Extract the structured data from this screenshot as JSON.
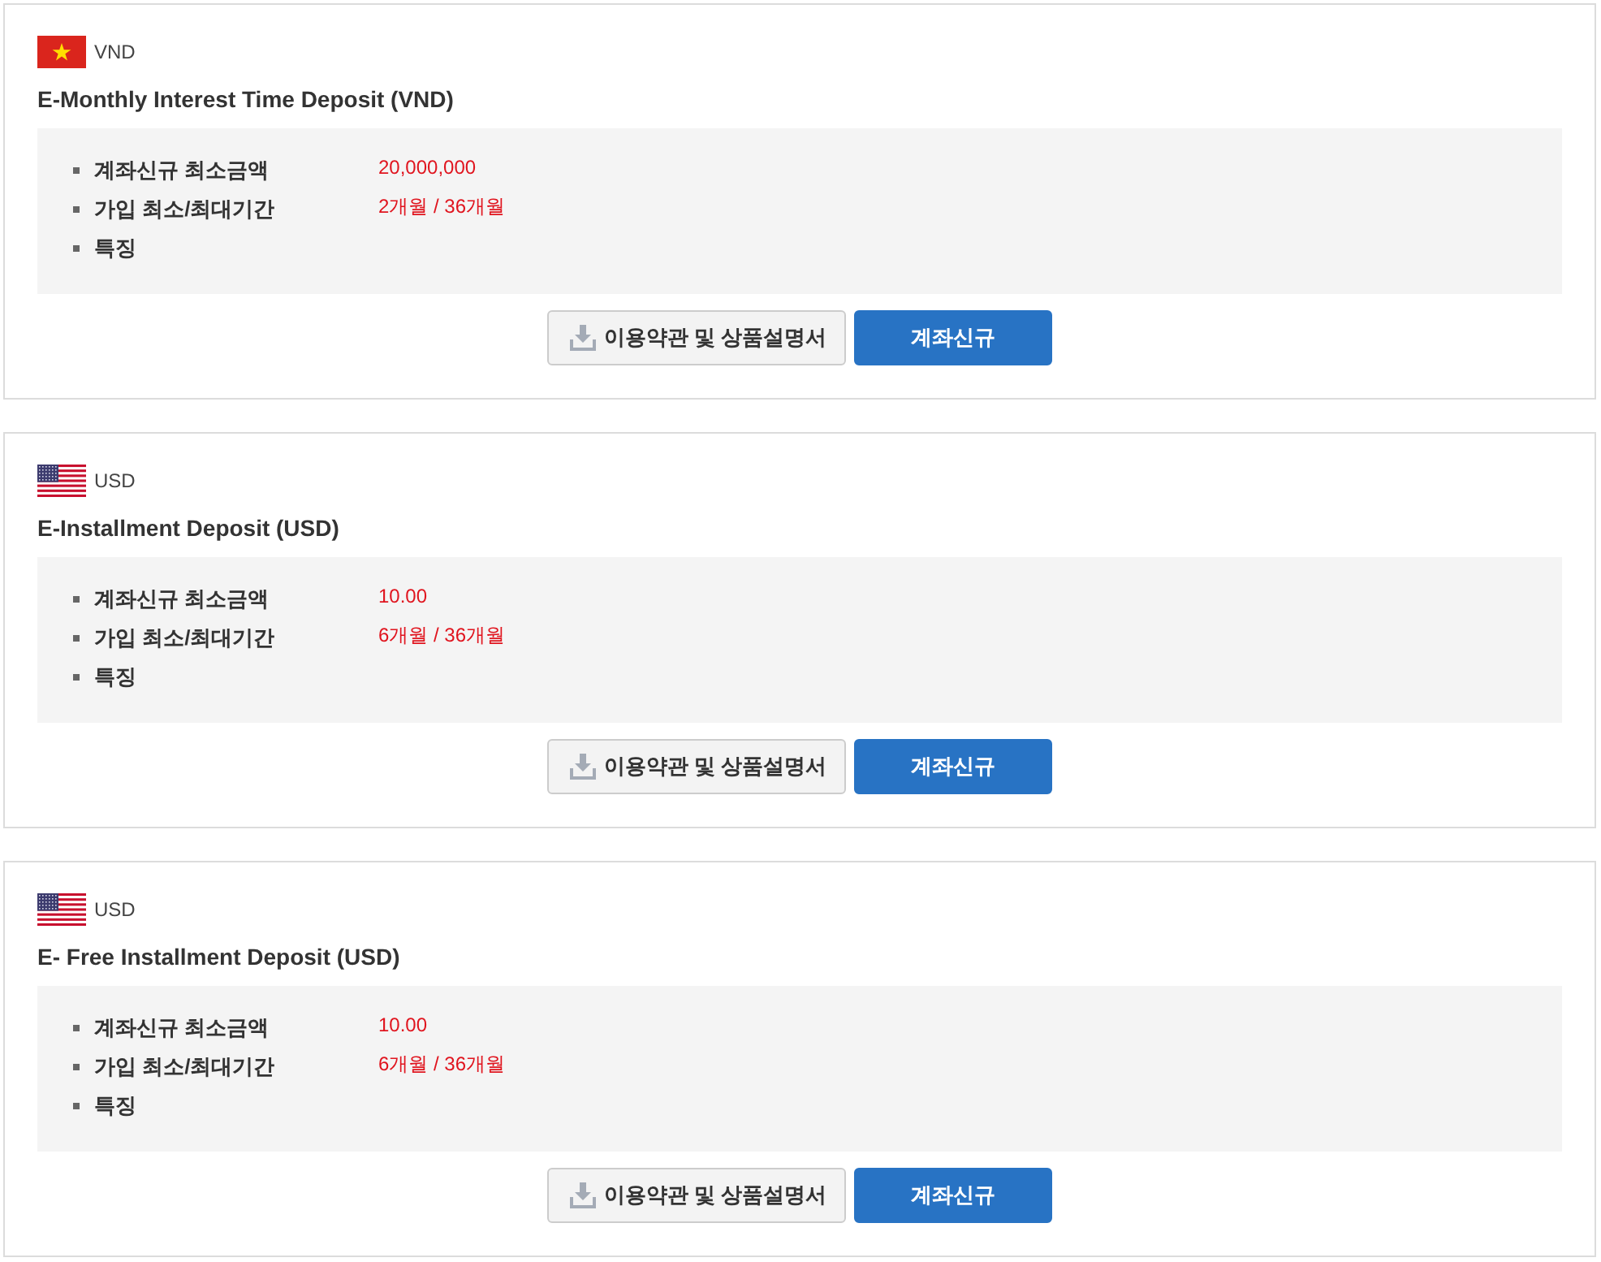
{
  "products": [
    {
      "currency": {
        "code": "VND",
        "kind": "vietnam"
      },
      "title": "E-Monthly Interest Time Deposit (VND)",
      "details": [
        {
          "label": "계좌신규 최소금액",
          "value": "20,000,000"
        },
        {
          "label": "가입 최소/최대기간",
          "value": "2개월 / 36개월"
        },
        {
          "label": "특징"
        }
      ],
      "buttons": [
        {
          "kind": "download",
          "label": "이용약관 및 상품설명서"
        },
        {
          "kind": "primary",
          "label": "계좌신규"
        }
      ]
    },
    {
      "currency": {
        "code": "USD",
        "kind": "usa"
      },
      "title": "E-Installment Deposit (USD)",
      "details": [
        {
          "label": "계좌신규 최소금액",
          "value": "10.00"
        },
        {
          "label": "가입 최소/최대기간",
          "value": "6개월 / 36개월"
        },
        {
          "label": "특징"
        }
      ],
      "buttons": [
        {
          "kind": "download",
          "label": "이용약관 및 상품설명서"
        },
        {
          "kind": "primary",
          "label": "계좌신규"
        }
      ]
    },
    {
      "currency": {
        "code": "USD",
        "kind": "usa"
      },
      "title": "E- Free Installment Deposit (USD)",
      "details": [
        {
          "label": "계좌신규 최소금액",
          "value": "10.00"
        },
        {
          "label": "가입 최소/최대기간",
          "value": "6개월 / 36개월"
        },
        {
          "label": "특징"
        }
      ],
      "buttons": [
        {
          "kind": "download",
          "label": "이용약관 및 상품설명서"
        },
        {
          "kind": "primary",
          "label": "계좌신규"
        }
      ]
    }
  ]
}
